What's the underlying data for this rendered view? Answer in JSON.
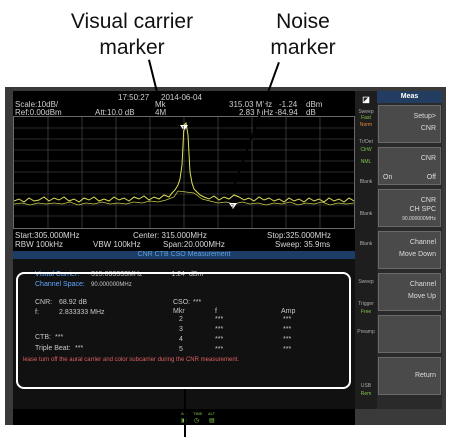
{
  "callouts": {
    "visual_carrier": [
      "Visual carrier",
      "marker"
    ],
    "noise": [
      "Noise",
      "marker"
    ]
  },
  "header": {
    "time": "17:50:27",
    "date": "2014-06-04",
    "scale": "Scale:10dB/",
    "ref": "Ref:0.00dBm",
    "att": "Att:10.0 dB",
    "mkr_label": "Mk",
    "mkr_mode": "4M",
    "marker1_freq": "315.03 MHz",
    "marker1_amp": "-1.24",
    "marker1_unit": "dBm",
    "marker2_freq": "2.83 MHz",
    "marker2_amp": "-84.94",
    "marker2_unit": "dB"
  },
  "footer": {
    "start": "Start:305.000MHz",
    "center": "Center: 315.000MHz",
    "stop": "Stop:325.000MHz",
    "rbw": "RBW 100kHz",
    "vbw": "VBW 100kHz",
    "span": "Span:20.000MHz",
    "sweep": "Sweep: 35.9ms"
  },
  "measurement": {
    "title": "CNR CTB CSO Measurement",
    "visual_carrier_label": "Visual Carrier:",
    "visual_carrier_freq": "315.033333MHz",
    "visual_carrier_amp": "-1.24",
    "visual_carrier_unit": "dBm",
    "channel_space_label": "Channel Space:",
    "channel_space_value": "90.000000MHz",
    "cnr_label": "CNR:",
    "cnr_value": "68.92 dB",
    "f_label": "f:",
    "f_value": "2.833333 MHz",
    "cso_label": "CSO:",
    "cso_value": "***",
    "col_mkr": "Mkr",
    "col_f": "f",
    "col_amp": "Amp",
    "rows": [
      {
        "mkr": "2",
        "f": "***",
        "amp": "***"
      },
      {
        "mkr": "3",
        "f": "***",
        "amp": "***"
      },
      {
        "mkr": "4",
        "f": "***",
        "amp": "***"
      },
      {
        "mkr": "5",
        "f": "***",
        "amp": "***"
      }
    ],
    "ctb_label": "CTB:",
    "ctb_value": "***",
    "triple_beat_label": "Triple Beat:",
    "triple_beat_value": "***",
    "warning": "lease turn off the aural carrier and color subcarrier during the CNR measurement."
  },
  "side_icons": {
    "sweep": "Sweep",
    "fast": "Fast",
    "norm": "Norm",
    "trdet": "Tr/Det",
    "clrw": "ClrW",
    "nml": "NML",
    "blank": "Blank",
    "trigger": "Trigger",
    "free": "Free",
    "preamp": "Preamp",
    "usb": "USB",
    "rem": "Rem"
  },
  "softkeys": {
    "title": "Meas",
    "setup_l1": "Setup>",
    "setup_l2": "CNR",
    "cnr_l1": "CNR",
    "cnr_l2": "Off",
    "cnr_on": "On",
    "chspc_l1": "CNR",
    "chspc_l2": "CH SPC",
    "chspc_val": "90.000000MHz",
    "move_down_l1": "Channel",
    "move_down_l2": "Move Down",
    "move_up_l1": "Channel",
    "move_up_l2": "Move Up",
    "return": "Return"
  },
  "status_bar": {
    "ac": "AC",
    "time": "TIME",
    "alt": "ALT"
  },
  "trace_color": "#e0e05a",
  "accent": "#233c62"
}
